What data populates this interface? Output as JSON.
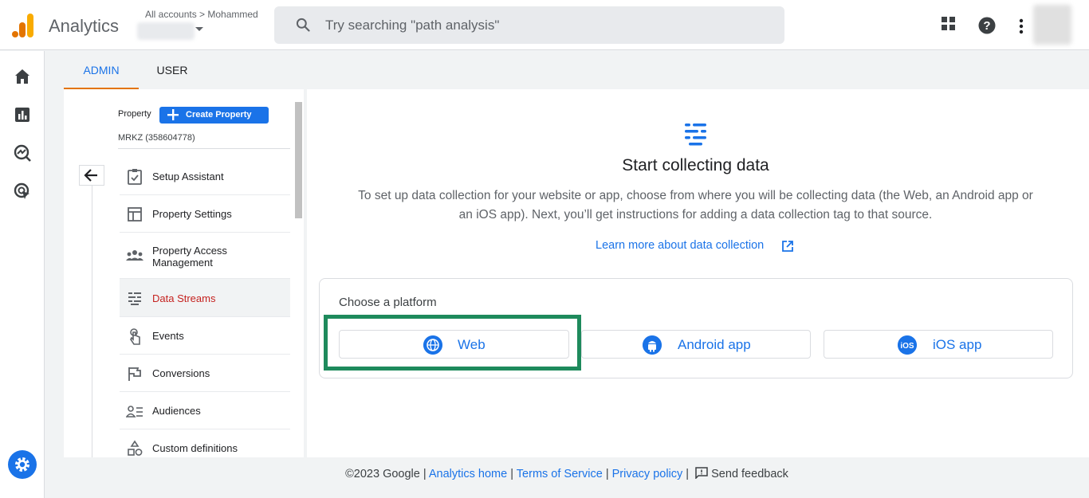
{
  "header": {
    "app_name": "Analytics",
    "account_crumb": "All accounts > Mohammed",
    "search_placeholder": "Try searching \"path analysis\""
  },
  "tabs": [
    {
      "label": "ADMIN",
      "active": true
    },
    {
      "label": "USER",
      "active": false
    }
  ],
  "property": {
    "label": "Property",
    "create_button": "Create Property",
    "id_text": "MRKZ (358604778)"
  },
  "nav": {
    "items": [
      {
        "label": "Setup Assistant",
        "icon": "checklist-icon",
        "active": false
      },
      {
        "label": "Property Settings",
        "icon": "property-settings-icon",
        "active": false
      },
      {
        "label": "Property Access Management",
        "icon": "people-icon",
        "active": false
      },
      {
        "label": "Data Streams",
        "icon": "data-streams-icon",
        "active": true
      },
      {
        "label": "Events",
        "icon": "touch-icon",
        "active": false
      },
      {
        "label": "Conversions",
        "icon": "flag-icon",
        "active": false
      },
      {
        "label": "Audiences",
        "icon": "audiences-icon",
        "active": false
      },
      {
        "label": "Custom definitions",
        "icon": "shapes-icon",
        "active": false
      }
    ]
  },
  "main": {
    "title": "Start collecting data",
    "description": "To set up data collection for your website or app, choose from where you will be collecting data (the Web, an Android app or an iOS app). Next, you’ll get instructions for adding a data collection tag to that source.",
    "learn_more": "Learn more about data collection",
    "choose_platform": "Choose a platform",
    "platforms": [
      {
        "label": "Web",
        "icon": "globe-icon",
        "highlighted": true
      },
      {
        "label": "Android app",
        "icon": "android-icon",
        "highlighted": false
      },
      {
        "label": "iOS app",
        "icon": "ios-icon",
        "highlighted": false
      }
    ]
  },
  "footer": {
    "copyright": "©2023 Google",
    "analytics_home": "Analytics home",
    "terms": "Terms of Service",
    "privacy": "Privacy policy",
    "feedback": "Send feedback"
  },
  "colors": {
    "accent": "#1a73e8",
    "tab_underline": "#e37400",
    "active_nav_text": "#c5221f",
    "highlight_box": "#1e8a5c"
  }
}
